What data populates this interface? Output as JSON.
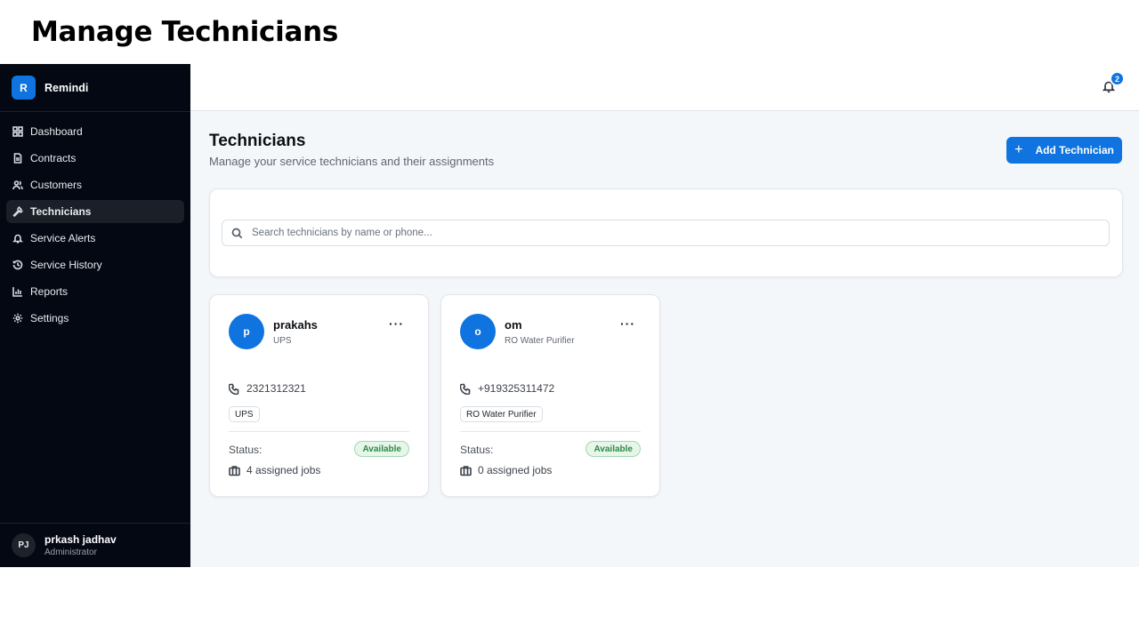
{
  "caption": "Manage Technicians",
  "brand": {
    "logo_letter": "R",
    "name": "Remindi"
  },
  "nav": [
    {
      "label": "Dashboard",
      "icon": "grid-icon"
    },
    {
      "label": "Contracts",
      "icon": "document-icon"
    },
    {
      "label": "Customers",
      "icon": "users-icon"
    },
    {
      "label": "Technicians",
      "icon": "wrench-icon",
      "active": true
    },
    {
      "label": "Service Alerts",
      "icon": "bell-icon"
    },
    {
      "label": "Service History",
      "icon": "history-icon"
    },
    {
      "label": "Reports",
      "icon": "bar-chart-icon"
    },
    {
      "label": "Settings",
      "icon": "gear-icon"
    }
  ],
  "user": {
    "initials": "PJ",
    "name": "prkash jadhav",
    "role": "Administrator"
  },
  "notifications": {
    "count": "2"
  },
  "header": {
    "title": "Technicians",
    "subtitle": "Manage your service technicians and their assignments",
    "add_button": "Add Technician"
  },
  "search": {
    "placeholder": "Search technicians by name or phone..."
  },
  "technicians": [
    {
      "initial": "p",
      "name": "prakahs",
      "specialty": "UPS",
      "phone": "2321312321",
      "tag": "UPS",
      "status_label": "Status:",
      "status": "Available",
      "jobs": "4 assigned jobs"
    },
    {
      "initial": "o",
      "name": "om",
      "specialty": "RO Water Purifier",
      "phone": "+919325311472",
      "tag": "RO Water Purifier",
      "status_label": "Status:",
      "status": "Available",
      "jobs": "0 assigned jobs"
    }
  ],
  "colors": {
    "accent": "#0f74df",
    "sidebar_bg": "#030812",
    "available_green": "#2c8a45"
  }
}
